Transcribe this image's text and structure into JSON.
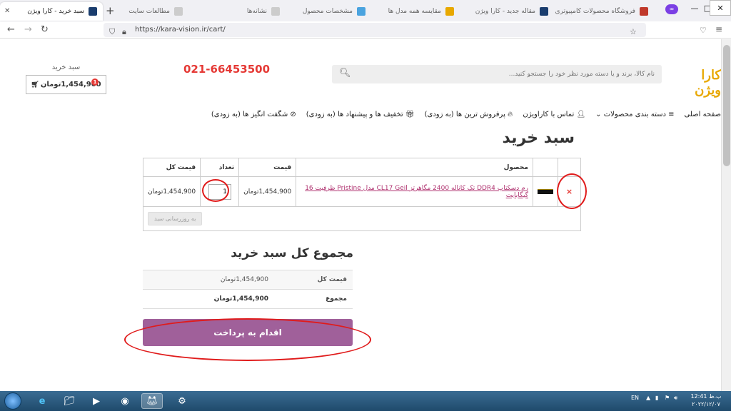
{
  "browser": {
    "active_tab_title": "سبد خرید - کارا ویژن",
    "other_tabs": [
      "مطالعات سایت",
      "نشانه‌ها",
      "مشخصات محصول",
      "مقایسه همه مدل ها",
      "مقاله جدید - کارا ویژن",
      "فروشگاه محصولات کامپیوتری"
    ],
    "url": "https://kara-vision.ir/cart/"
  },
  "header": {
    "logo_text": "کارا ویژن",
    "search_placeholder": "نام کالا، برند و یا دسته مورد نظر خود را جستجو کنید...",
    "phone": "021-66453500",
    "cart_label": "سبد خرید",
    "cart_total": "1,454,900تومان",
    "cart_count": "1"
  },
  "menu": {
    "items": [
      "صفحه اصلی",
      "دسته بندی محصولات",
      "تماس با کاراویژن",
      "پرفروش ترین ها (به زودی)",
      "تخفیف ها و پیشنهاد ها (به زودی)",
      "شگفت انگیز ها (به زودی)"
    ]
  },
  "cart": {
    "title": "سبد خرید",
    "columns": {
      "product": "محصول",
      "price": "قیمت",
      "quantity": "تعداد",
      "subtotal": "قیمت کل"
    },
    "items": [
      {
        "name": "رم دسکتاپ DDR4 تک کاناله 2400 مگاهرتز CL17 Geil مدل Pristine ظرفیت 16 گیگابایت",
        "price": "1,454,900تومان",
        "quantity": "1",
        "subtotal": "1,454,900تومان"
      }
    ],
    "remove_symbol": "×",
    "update_button": "به روزرسانی سبد"
  },
  "totals": {
    "title": "مجموع کل سبد خرید",
    "rows": [
      {
        "label": "قیمت کل",
        "value": "1,454,900تومان"
      },
      {
        "label": "مجموع",
        "value": "1,454,900تومان"
      }
    ],
    "checkout_button": "اقدام به پرداخت"
  },
  "taskbar": {
    "language": "EN",
    "time": "12:41 ب.ظ",
    "date": "۲۰۲۲/۱۲/۰۷"
  },
  "colors": {
    "accent": "#a0609a",
    "phone": "#e53935",
    "logo": "#e8a800",
    "annotation": "#e01b1b"
  }
}
